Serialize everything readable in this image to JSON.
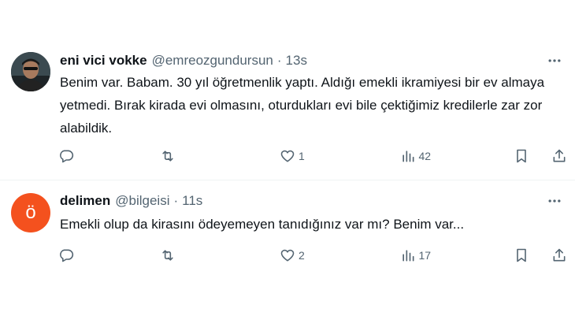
{
  "tweets": [
    {
      "name": "eni vici vokke",
      "handle": "@emreozgundursun",
      "separator": "·",
      "time": "13s",
      "text": "Benim var. Babam. 30 yıl öğretmenlik yaptı. Aldığı emekli ikramiyesi bir ev almaya yetmedi. Bırak kirada evi olmasını, oturdukları evi bile çektiğimiz kredilerle zar zor alabildik.",
      "avatar": {
        "type": "photo"
      },
      "counts": {
        "replies": "",
        "retweets": "",
        "likes": "1",
        "views": "42"
      }
    },
    {
      "name": "delimen",
      "handle": "@bilgeisi",
      "separator": "·",
      "time": "11s",
      "text": "Emekli olup da kirasını ödeyemeyen tanıdığınız var mı? Benim var...",
      "avatar": {
        "type": "letter",
        "letter": "ö",
        "color": "#f4511e"
      },
      "counts": {
        "replies": "",
        "retweets": "",
        "likes": "2",
        "views": "17"
      }
    }
  ],
  "icons": {
    "more": "more-horizontal-icon",
    "reply": "reply-icon",
    "retweet": "retweet-icon",
    "like": "heart-icon",
    "views": "views-chart-icon",
    "bookmark": "bookmark-icon",
    "share": "share-icon"
  },
  "colors": {
    "text": "#0f1419",
    "secondary": "#536471",
    "divider": "#eff3f4"
  }
}
